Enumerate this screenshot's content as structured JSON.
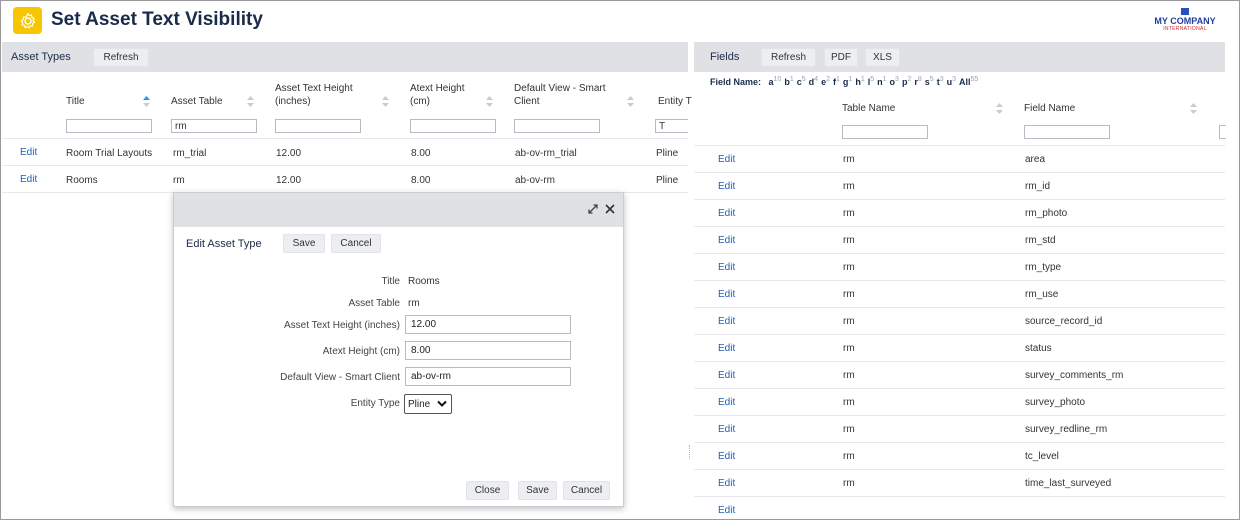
{
  "app": {
    "title": "Set Asset Text Visibility"
  },
  "logo": {
    "line1": "MY COMPANY",
    "line2": "INTERNATIONAL"
  },
  "asset_types": {
    "title": "Asset Types",
    "refresh_label": "Refresh",
    "columns": [
      "Title",
      "Asset Table",
      "Asset Text Height (inches)",
      "Atext Height (cm)",
      "Default View - Smart Client",
      "Entity T"
    ],
    "filters": [
      "",
      "rm",
      "",
      "",
      "",
      "T"
    ],
    "edit_label": "Edit",
    "rows": [
      {
        "title": "Room Trial Layouts",
        "table": "rm_trial",
        "text_height": "12.00",
        "atext_cm": "8.00",
        "view": "ab-ov-rm_trial",
        "entity": "Pline"
      },
      {
        "title": "Rooms",
        "table": "rm",
        "text_height": "12.00",
        "atext_cm": "8.00",
        "view": "ab-ov-rm",
        "entity": "Pline"
      }
    ]
  },
  "fields": {
    "title": "Fields",
    "refresh_label": "Refresh",
    "pdf_label": "PDF",
    "xls_label": "XLS",
    "field_name_label": "Field Name:",
    "letters": [
      {
        "letter": "a",
        "count": "10"
      },
      {
        "letter": "b",
        "count": "1"
      },
      {
        "letter": "c",
        "count": "5"
      },
      {
        "letter": "d",
        "count": "4"
      },
      {
        "letter": "e",
        "count": "2"
      },
      {
        "letter": "f",
        "count": "1"
      },
      {
        "letter": "g",
        "count": "1"
      },
      {
        "letter": "h",
        "count": "1"
      },
      {
        "letter": "l",
        "count": "5"
      },
      {
        "letter": "n",
        "count": "1"
      },
      {
        "letter": "o",
        "count": "3"
      },
      {
        "letter": "p",
        "count": "2"
      },
      {
        "letter": "r",
        "count": "8"
      },
      {
        "letter": "s",
        "count": "5"
      },
      {
        "letter": "t",
        "count": "3"
      },
      {
        "letter": "u",
        "count": "3"
      },
      {
        "letter": "All",
        "count": "55"
      }
    ],
    "columns": [
      "Table Name",
      "Field Name"
    ],
    "edit_label": "Edit",
    "rows": [
      {
        "table": "rm",
        "field": "area"
      },
      {
        "table": "rm",
        "field": "rm_id"
      },
      {
        "table": "rm",
        "field": "rm_photo"
      },
      {
        "table": "rm",
        "field": "rm_std"
      },
      {
        "table": "rm",
        "field": "rm_type"
      },
      {
        "table": "rm",
        "field": "rm_use"
      },
      {
        "table": "rm",
        "field": "source_record_id"
      },
      {
        "table": "rm",
        "field": "status"
      },
      {
        "table": "rm",
        "field": "survey_comments_rm"
      },
      {
        "table": "rm",
        "field": "survey_photo"
      },
      {
        "table": "rm",
        "field": "survey_redline_rm"
      },
      {
        "table": "rm",
        "field": "tc_level"
      },
      {
        "table": "rm",
        "field": "time_last_surveyed"
      }
    ]
  },
  "dialog": {
    "section_title": "Edit Asset Type",
    "save_label": "Save",
    "cancel_label": "Cancel",
    "close_label": "Close",
    "form": {
      "title_label": "Title",
      "title_value": "Rooms",
      "table_label": "Asset Table",
      "table_value": "rm",
      "text_height_label": "Asset Text Height (inches)",
      "text_height_value": "12.00",
      "atext_label": "Atext Height (cm)",
      "atext_value": "8.00",
      "view_label": "Default View - Smart Client",
      "view_value": "ab-ov-rm",
      "entity_label": "Entity Type",
      "entity_value": "Pline"
    }
  },
  "colors": {
    "accent": "#f7c600",
    "link": "#1f5fb8",
    "header_bar": "#dfe1e4",
    "title_text": "#1a2b4a"
  },
  "icons": [
    "gear-icon",
    "sort-icon",
    "sort-asc-icon",
    "maximize-icon",
    "close-icon",
    "chevron-down-icon"
  ]
}
